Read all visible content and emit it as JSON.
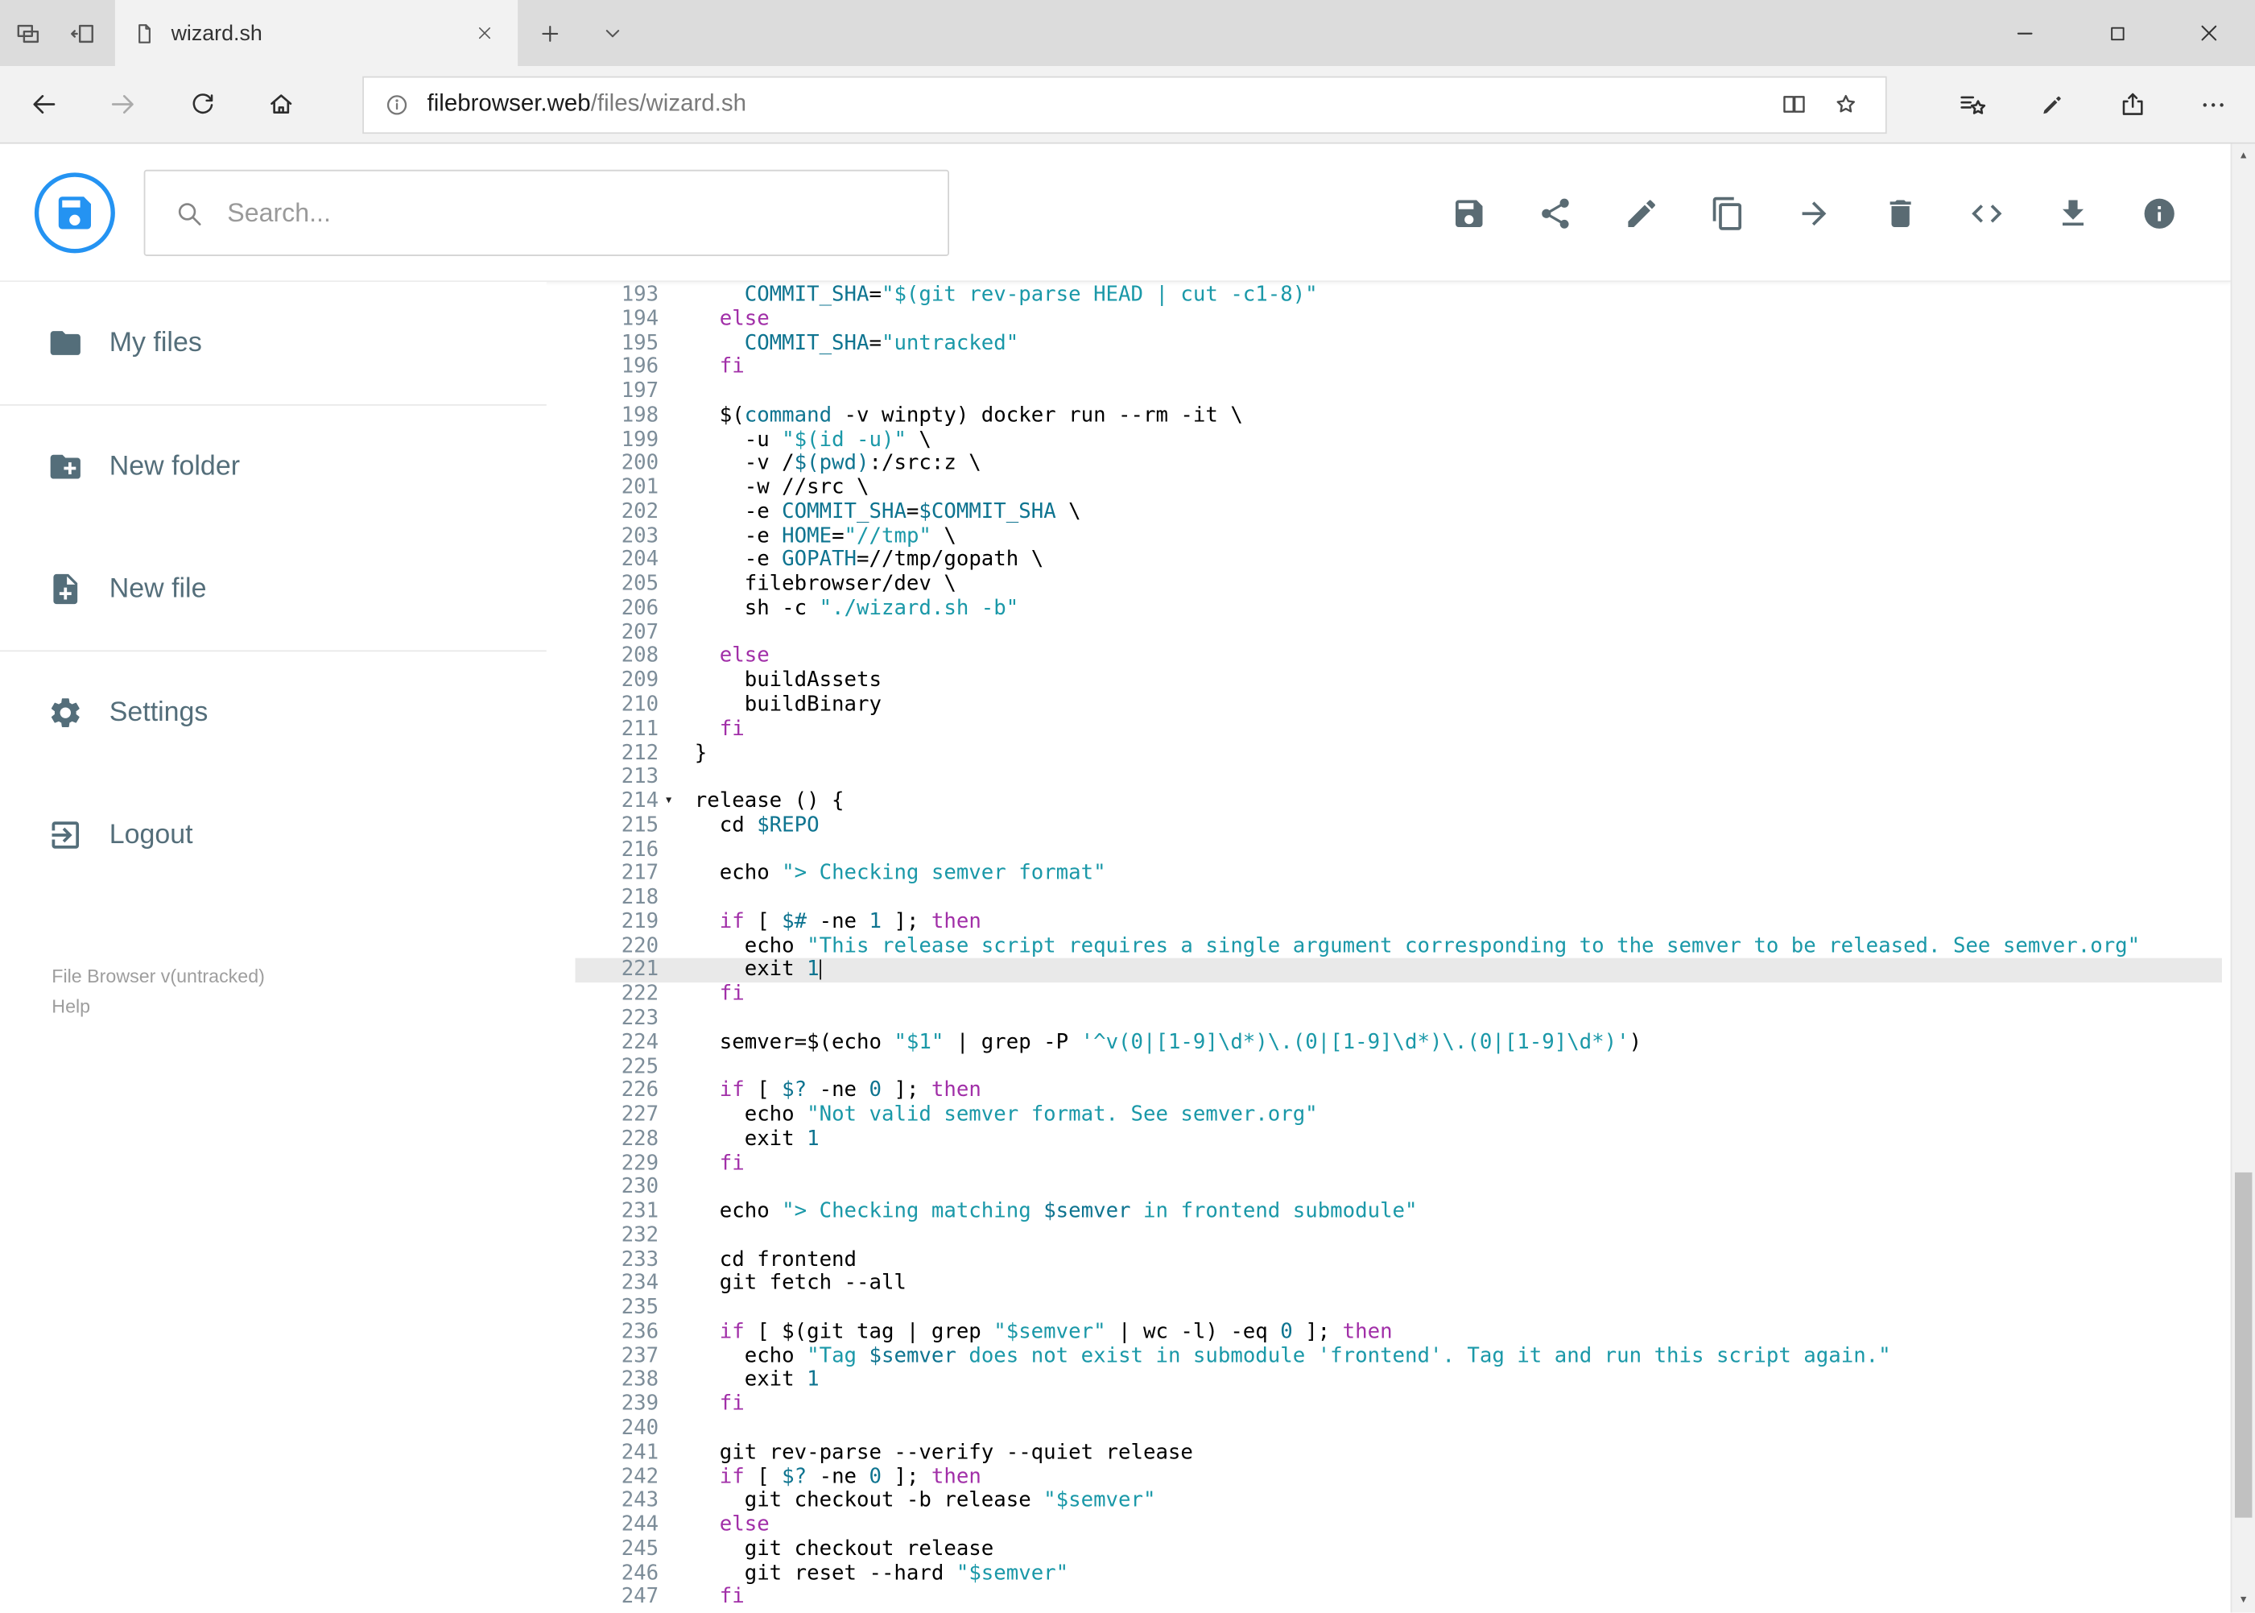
{
  "browser": {
    "tab_title": "wizard.sh",
    "url": {
      "host": "filebrowser.web",
      "path": "/files/wizard.sh"
    }
  },
  "toolbar": {
    "search_placeholder": "Search...",
    "actions": [
      {
        "id": "save",
        "icon": "save"
      },
      {
        "id": "share",
        "icon": "share"
      },
      {
        "id": "edit",
        "icon": "edit"
      },
      {
        "id": "copy",
        "icon": "copy"
      },
      {
        "id": "move",
        "icon": "move"
      },
      {
        "id": "delete",
        "icon": "delete"
      },
      {
        "id": "code",
        "icon": "code"
      },
      {
        "id": "download",
        "icon": "download"
      },
      {
        "id": "info",
        "icon": "info"
      }
    ]
  },
  "sidebar": {
    "items": [
      {
        "id": "my-files",
        "label": "My files",
        "icon": "folder",
        "divider_after": true
      },
      {
        "id": "new-folder",
        "label": "New folder",
        "icon": "create-new-folder",
        "divider_after": false
      },
      {
        "id": "new-file",
        "label": "New file",
        "icon": "note-add",
        "divider_after": true
      },
      {
        "id": "settings",
        "label": "Settings",
        "icon": "settings",
        "divider_after": false
      },
      {
        "id": "logout",
        "label": "Logout",
        "icon": "logout",
        "divider_after": false
      }
    ],
    "footer": {
      "version": "File Browser v(untracked)",
      "help": "Help"
    }
  },
  "editor": {
    "active_line": 221,
    "fold_marker_line": 214,
    "lines": [
      {
        "n": 193,
        "seg": [
          [
            "p",
            "    "
          ],
          [
            "v",
            "COMMIT_SHA"
          ],
          [
            "p",
            "="
          ],
          [
            "s",
            "\"$(git rev-parse HEAD | cut -c1-8)\""
          ]
        ]
      },
      {
        "n": 194,
        "seg": [
          [
            "p",
            "  "
          ],
          [
            "k",
            "else"
          ]
        ]
      },
      {
        "n": 195,
        "seg": [
          [
            "p",
            "    "
          ],
          [
            "v",
            "COMMIT_SHA"
          ],
          [
            "p",
            "="
          ],
          [
            "s",
            "\"untracked\""
          ]
        ]
      },
      {
        "n": 196,
        "seg": [
          [
            "p",
            "  "
          ],
          [
            "k",
            "fi"
          ]
        ]
      },
      {
        "n": 197,
        "seg": []
      },
      {
        "n": 198,
        "seg": [
          [
            "p",
            "  $("
          ],
          [
            "v",
            "command"
          ],
          [
            "p",
            " -v winpty) docker run --rm -it \\"
          ]
        ]
      },
      {
        "n": 199,
        "seg": [
          [
            "p",
            "    -u "
          ],
          [
            "s",
            "\"$(id -u)\""
          ],
          [
            "p",
            " \\"
          ]
        ]
      },
      {
        "n": 200,
        "seg": [
          [
            "p",
            "    -v /"
          ],
          [
            "v",
            "$(pwd)"
          ],
          [
            "p",
            ":/src:z \\"
          ]
        ]
      },
      {
        "n": 201,
        "seg": [
          [
            "p",
            "    -w //src \\"
          ]
        ]
      },
      {
        "n": 202,
        "seg": [
          [
            "p",
            "    -e "
          ],
          [
            "v",
            "COMMIT_SHA"
          ],
          [
            "p",
            "="
          ],
          [
            "v",
            "$COMMIT_SHA"
          ],
          [
            "p",
            " \\"
          ]
        ]
      },
      {
        "n": 203,
        "seg": [
          [
            "p",
            "    -e "
          ],
          [
            "v",
            "HOME"
          ],
          [
            "p",
            "="
          ],
          [
            "s",
            "\"//tmp\""
          ],
          [
            "p",
            " \\"
          ]
        ]
      },
      {
        "n": 204,
        "seg": [
          [
            "p",
            "    -e "
          ],
          [
            "v",
            "GOPATH"
          ],
          [
            "p",
            "=//tmp/gopath \\"
          ]
        ]
      },
      {
        "n": 205,
        "seg": [
          [
            "p",
            "    filebrowser/dev \\"
          ]
        ]
      },
      {
        "n": 206,
        "seg": [
          [
            "p",
            "    sh -c "
          ],
          [
            "s",
            "\"./wizard.sh -b\""
          ]
        ]
      },
      {
        "n": 207,
        "seg": []
      },
      {
        "n": 208,
        "seg": [
          [
            "p",
            "  "
          ],
          [
            "k",
            "else"
          ]
        ]
      },
      {
        "n": 209,
        "seg": [
          [
            "p",
            "    buildAssets"
          ]
        ]
      },
      {
        "n": 210,
        "seg": [
          [
            "p",
            "    buildBinary"
          ]
        ]
      },
      {
        "n": 211,
        "seg": [
          [
            "p",
            "  "
          ],
          [
            "k",
            "fi"
          ]
        ]
      },
      {
        "n": 212,
        "seg": [
          [
            "p",
            "}"
          ]
        ]
      },
      {
        "n": 213,
        "seg": []
      },
      {
        "n": 214,
        "seg": [
          [
            "p",
            "release () {"
          ]
        ]
      },
      {
        "n": 215,
        "seg": [
          [
            "p",
            "  cd "
          ],
          [
            "v",
            "$REPO"
          ]
        ]
      },
      {
        "n": 216,
        "seg": []
      },
      {
        "n": 217,
        "seg": [
          [
            "p",
            "  echo "
          ],
          [
            "s",
            "\"> Checking semver format\""
          ]
        ]
      },
      {
        "n": 218,
        "seg": []
      },
      {
        "n": 219,
        "seg": [
          [
            "p",
            "  "
          ],
          [
            "k",
            "if"
          ],
          [
            "p",
            " [ "
          ],
          [
            "v",
            "$#"
          ],
          [
            "p",
            " -ne "
          ],
          [
            "n",
            "1"
          ],
          [
            "p",
            " ]; "
          ],
          [
            "k",
            "then"
          ]
        ]
      },
      {
        "n": 220,
        "seg": [
          [
            "p",
            "    echo "
          ],
          [
            "s",
            "\"This release script requires a single argument corresponding to the semver to be released. See semver.org\""
          ]
        ]
      },
      {
        "n": 221,
        "seg": [
          [
            "p",
            "    exit "
          ],
          [
            "n",
            "1"
          ]
        ]
      },
      {
        "n": 222,
        "seg": [
          [
            "p",
            "  "
          ],
          [
            "k",
            "fi"
          ]
        ]
      },
      {
        "n": 223,
        "seg": []
      },
      {
        "n": 224,
        "seg": [
          [
            "p",
            "  semver=$(echo "
          ],
          [
            "s",
            "\"$1\""
          ],
          [
            "p",
            " | grep -P "
          ],
          [
            "s",
            "'^v(0|[1-9]\\d*)\\.(0|[1-9]\\d*)\\.(0|[1-9]\\d*)'"
          ],
          [
            "p",
            ")"
          ]
        ]
      },
      {
        "n": 225,
        "seg": []
      },
      {
        "n": 226,
        "seg": [
          [
            "p",
            "  "
          ],
          [
            "k",
            "if"
          ],
          [
            "p",
            " [ "
          ],
          [
            "v",
            "$?"
          ],
          [
            "p",
            " -ne "
          ],
          [
            "n",
            "0"
          ],
          [
            "p",
            " ]; "
          ],
          [
            "k",
            "then"
          ]
        ]
      },
      {
        "n": 227,
        "seg": [
          [
            "p",
            "    echo "
          ],
          [
            "s",
            "\"Not valid semver format. See semver.org\""
          ]
        ]
      },
      {
        "n": 228,
        "seg": [
          [
            "p",
            "    exit "
          ],
          [
            "n",
            "1"
          ]
        ]
      },
      {
        "n": 229,
        "seg": [
          [
            "p",
            "  "
          ],
          [
            "k",
            "fi"
          ]
        ]
      },
      {
        "n": 230,
        "seg": []
      },
      {
        "n": 231,
        "seg": [
          [
            "p",
            "  echo "
          ],
          [
            "s",
            "\"> Checking matching "
          ],
          [
            "v",
            "$semver"
          ],
          [
            "s",
            " in frontend submodule\""
          ]
        ]
      },
      {
        "n": 232,
        "seg": []
      },
      {
        "n": 233,
        "seg": [
          [
            "p",
            "  cd frontend"
          ]
        ]
      },
      {
        "n": 234,
        "seg": [
          [
            "p",
            "  git fetch --all"
          ]
        ]
      },
      {
        "n": 235,
        "seg": []
      },
      {
        "n": 236,
        "seg": [
          [
            "p",
            "  "
          ],
          [
            "k",
            "if"
          ],
          [
            "p",
            " [ $(git tag | grep "
          ],
          [
            "s",
            "\"$semver\""
          ],
          [
            "p",
            " | wc -l) -eq "
          ],
          [
            "n",
            "0"
          ],
          [
            "p",
            " ]; "
          ],
          [
            "k",
            "then"
          ]
        ]
      },
      {
        "n": 237,
        "seg": [
          [
            "p",
            "    echo "
          ],
          [
            "s",
            "\"Tag "
          ],
          [
            "v",
            "$semver"
          ],
          [
            "s",
            " does not exist in submodule 'frontend'. Tag it and run this script again.\""
          ]
        ]
      },
      {
        "n": 238,
        "seg": [
          [
            "p",
            "    exit "
          ],
          [
            "n",
            "1"
          ]
        ]
      },
      {
        "n": 239,
        "seg": [
          [
            "p",
            "  "
          ],
          [
            "k",
            "fi"
          ]
        ]
      },
      {
        "n": 240,
        "seg": []
      },
      {
        "n": 241,
        "seg": [
          [
            "p",
            "  git rev-parse --verify --quiet release"
          ]
        ]
      },
      {
        "n": 242,
        "seg": [
          [
            "p",
            "  "
          ],
          [
            "k",
            "if"
          ],
          [
            "p",
            " [ "
          ],
          [
            "v",
            "$?"
          ],
          [
            "p",
            " -ne "
          ],
          [
            "n",
            "0"
          ],
          [
            "p",
            " ]; "
          ],
          [
            "k",
            "then"
          ]
        ]
      },
      {
        "n": 243,
        "seg": [
          [
            "p",
            "    git checkout -b release "
          ],
          [
            "s",
            "\"$semver\""
          ]
        ]
      },
      {
        "n": 244,
        "seg": [
          [
            "p",
            "  "
          ],
          [
            "k",
            "else"
          ]
        ]
      },
      {
        "n": 245,
        "seg": [
          [
            "p",
            "    git checkout release"
          ]
        ]
      },
      {
        "n": 246,
        "seg": [
          [
            "p",
            "    git reset --hard "
          ],
          [
            "s",
            "\"$semver\""
          ]
        ]
      },
      {
        "n": 247,
        "seg": [
          [
            "p",
            "  "
          ],
          [
            "k",
            "fi"
          ]
        ]
      }
    ]
  },
  "colors": {
    "accent": "#2493f2",
    "keyword": "#a12fa8",
    "string": "#1a98a8",
    "variable": "#0e7490",
    "number": "#0e7490",
    "line_number": "#7d8d99",
    "active_line_bg": "#e9e9e9"
  }
}
